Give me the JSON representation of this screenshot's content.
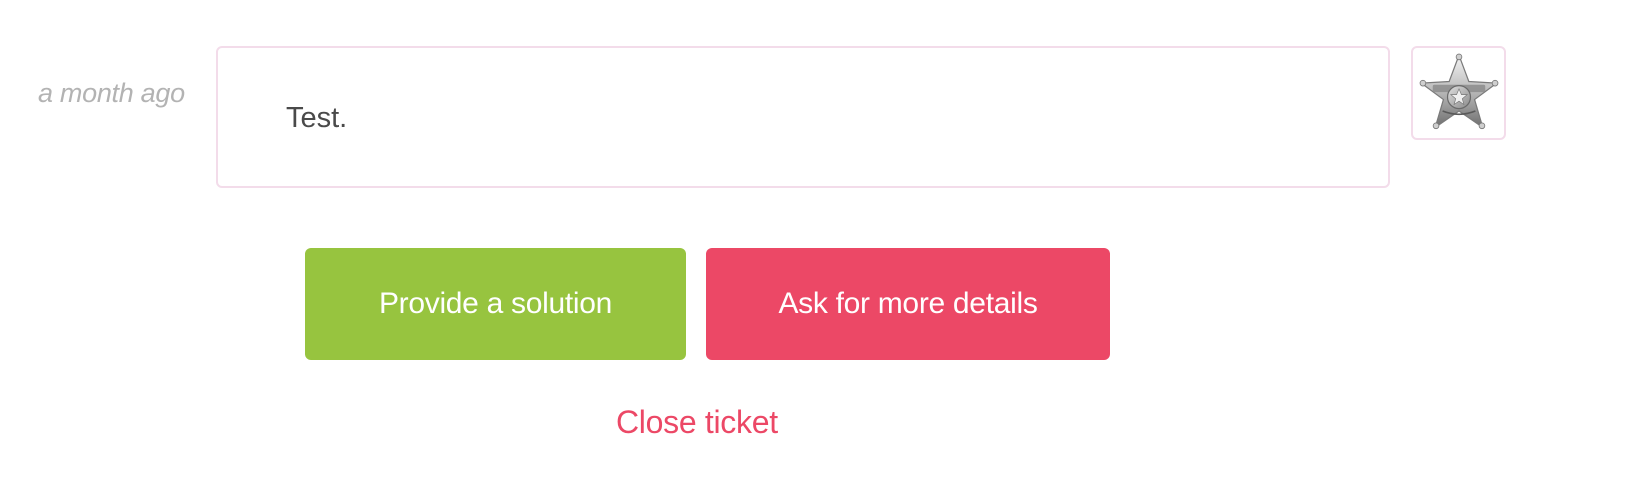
{
  "message": {
    "timestamp": "a month ago",
    "text": "Test.",
    "avatar_icon": "sheriff-star-badge-icon"
  },
  "actions": {
    "provide_solution_label": "Provide a solution",
    "ask_details_label": "Ask for more details",
    "close_ticket_label": "Close ticket"
  },
  "colors": {
    "solution_button": "#97c43f",
    "details_button": "#ec4866",
    "close_link": "#ec4866",
    "bubble_border": "#f3dcea",
    "timestamp_text": "#b3b3b3"
  }
}
